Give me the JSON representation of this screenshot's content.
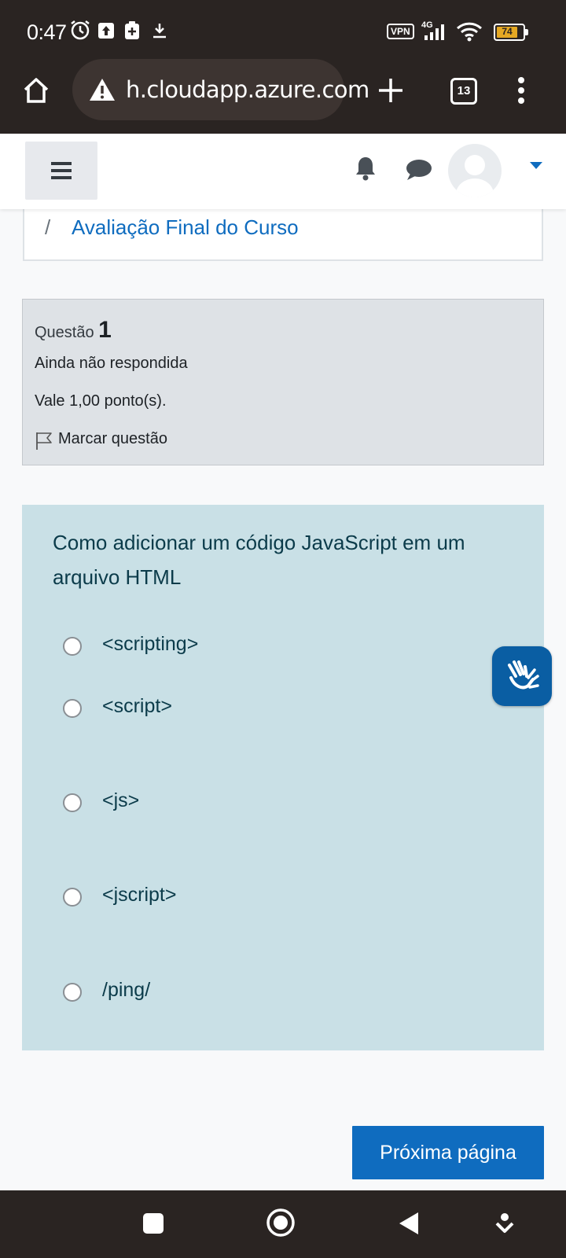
{
  "status_bar": {
    "time": "0:47",
    "vpn": "VPN",
    "network": "4G",
    "battery": "74"
  },
  "browser": {
    "url": "h.cloudapp.azure.com",
    "tab_count": "13"
  },
  "breadcrumb": {
    "separator": "/",
    "current": "Avaliação Final do Curso"
  },
  "question_info": {
    "label": "Questão",
    "number": "1",
    "state": "Ainda não respondida",
    "grade": "Vale 1,00 ponto(s).",
    "flag_label": "Marcar questão"
  },
  "question": {
    "text": "Como adicionar um código JavaScript em um arquivo HTML",
    "answers": [
      "<scripting>",
      "<script>",
      "<js>",
      "<jscript>",
      "/ping/"
    ]
  },
  "buttons": {
    "next": "Próxima página"
  },
  "colors": {
    "primary": "#0f6cbf",
    "question_bg": "#c9e0e6",
    "info_bg": "#dee2e6",
    "system_bar": "#2a2422"
  }
}
